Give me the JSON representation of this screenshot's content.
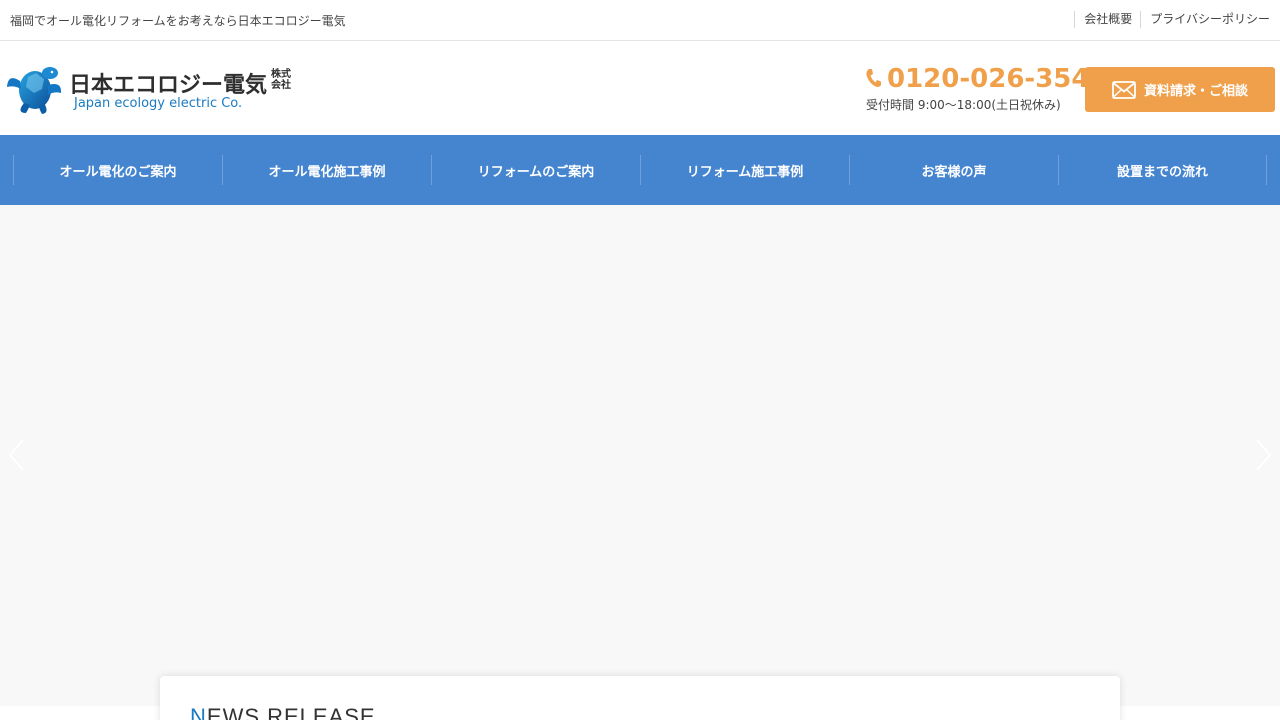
{
  "topbar": {
    "tagline": "福岡でオール電化リフォームをお考えなら日本エコロジー電気",
    "links": [
      {
        "label": "会社概要"
      },
      {
        "label": "プライバシーポリシー"
      }
    ]
  },
  "header": {
    "logo_text": "日本エコロジー電気",
    "logo_kabu": "株式会社",
    "logo_sub": "Japan ecology electric Co.",
    "phone_number": "0120-026-354",
    "phone_hours": "受付時間 9:00〜18:00(土日祝休み)",
    "contact_label": "資料請求・ご相談"
  },
  "nav": {
    "items": [
      {
        "label": "オール電化のご案内"
      },
      {
        "label": "オール電化施工事例"
      },
      {
        "label": "リフォームのご案内"
      },
      {
        "label": "リフォーム施工事例"
      },
      {
        "label": "お客様の声"
      },
      {
        "label": "設置までの流れ"
      }
    ]
  },
  "news": {
    "title_first": "N",
    "title_rest": "EWS RELEASE"
  },
  "colors": {
    "accent_orange": "#f0a04b",
    "nav_blue": "#4585d0",
    "brand_blue": "#1a7bc2"
  },
  "icons": {
    "logo": "turtle-logo-icon",
    "phone": "phone-icon",
    "mail": "mail-icon",
    "prev": "chevron-left-icon",
    "next": "chevron-right-icon"
  }
}
